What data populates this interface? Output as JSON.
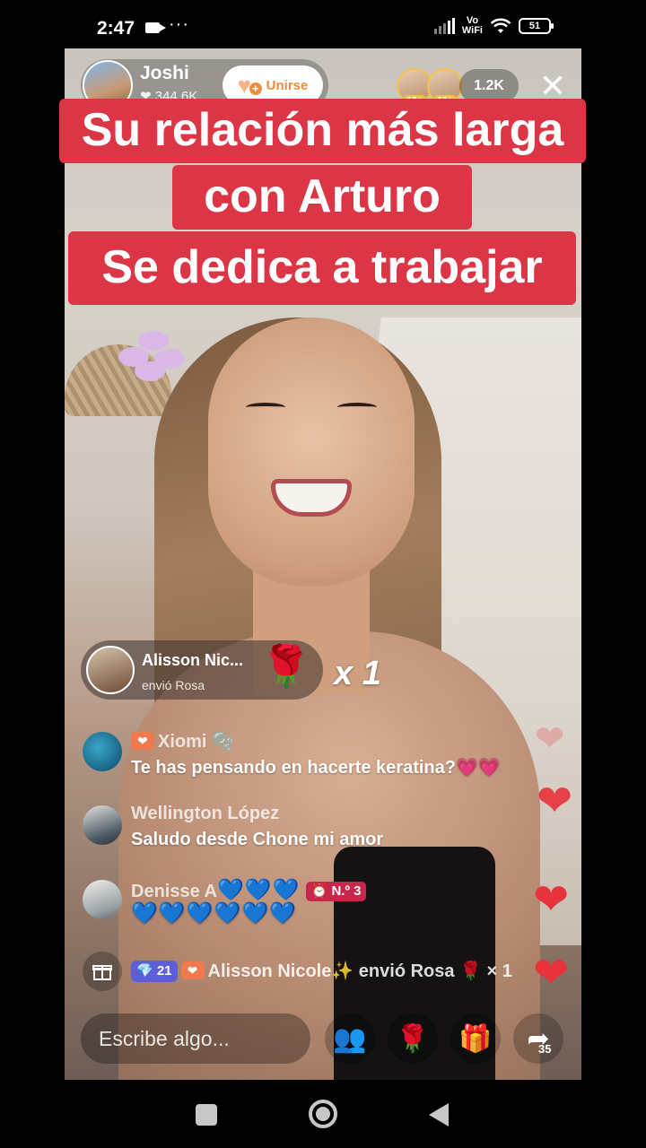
{
  "status_bar": {
    "time": "2:47",
    "more": "···",
    "network_top": "Vo",
    "network_bottom": "WiFi",
    "battery": "51"
  },
  "host": {
    "name": "Joshi",
    "likes": "❤ 344.6K",
    "join_label": "Unirse"
  },
  "viewers": {
    "badge": "10+",
    "count": "1.2K",
    "close": "✕"
  },
  "captions": [
    "Su relación más larga",
    "con Arturo",
    "Se dedica a trabajar"
  ],
  "gift_banner": {
    "user": "Alisson Nic...",
    "sub": "envió Rosa",
    "gift_icon": "🌹",
    "multiplier": "x 1"
  },
  "chat": [
    {
      "name": "Xiomi 🫧",
      "badge": "❤",
      "text": "Te has pensando en hacerte keratina?💗💗"
    },
    {
      "name": "Wellington López",
      "text": "Saludo desde Chone mi amor"
    },
    {
      "name": "Denisse A",
      "name_hearts": "💙💙💙",
      "rank": "⏰ N.º 3",
      "text": "💙💙💙💙💙💙"
    }
  ],
  "ticker": {
    "level": "💎 21",
    "badge": "❤",
    "text": "Alisson Nicole✨ envió Rosa 🌹 × 1"
  },
  "bottom_bar": {
    "placeholder": "Escribe algo...",
    "share_count": "35",
    "rose_icon": "🌹",
    "gift_icon": "🎁",
    "people_icon": "👥",
    "share_icon": "➦"
  },
  "colors": {
    "caption_bg": "#dc3545",
    "join_accent": "#f08b3c",
    "heart": "#e8323c"
  }
}
